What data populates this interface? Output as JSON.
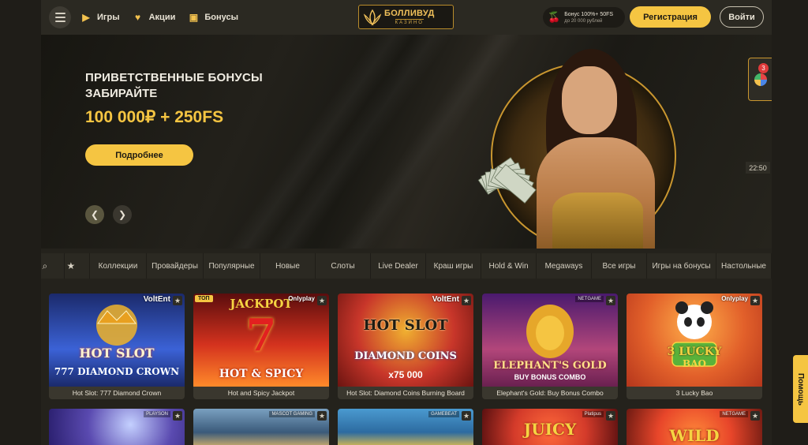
{
  "header": {
    "nav": [
      {
        "label": "Игры",
        "icon": "play-icon"
      },
      {
        "label": "Акции",
        "icon": "heart-icon"
      },
      {
        "label": "Бонусы",
        "icon": "gift-icon"
      }
    ],
    "logo_main": "БОЛЛИВУД",
    "logo_sub": "КАЗИНО",
    "promo_line1": "Бонус 100%+ 50FS",
    "promo_line2": "до 20 000 рублей",
    "register_label": "Регистрация",
    "login_label": "Войти"
  },
  "banner": {
    "line1": "ПРИВЕТСТВЕННЫЕ БОНУСЫ",
    "line2": "ЗАБИРАЙТЕ",
    "line3": "100 000₽ + 250FS",
    "button_label": "Подробнее",
    "time": "22:50",
    "notification_count": "3"
  },
  "categories": [
    "Коллекции",
    "Провайдеры",
    "Популярные",
    "Новые",
    "Слоты",
    "Live Dealer",
    "Краш игры",
    "Hold & Win",
    "Megaways",
    "Все игры",
    "Игры на бонусы",
    "Настольные"
  ],
  "games": [
    {
      "name": "Hot Slot: 777 Diamond Crown",
      "provider": "VoltEnt",
      "art_title": "HOT SLOT",
      "art_sub": "777 DIAMOND CROWN",
      "colors": [
        "#1b2a6b",
        "#3b62d6"
      ]
    },
    {
      "name": "Hot and Spicy Jackpot",
      "provider": "Onlyplay",
      "art_title": "JACKPOT",
      "art_sub": "HOT & SPICY",
      "badge": "ТОП",
      "colors": [
        "#5a0d0d",
        "#d4321e"
      ]
    },
    {
      "name": "Hot Slot: Diamond Coins Burning Board",
      "provider": "VoltEnt",
      "art_title": "HOT SLOT",
      "art_sub": "DIAMOND COINS",
      "art_extra": "x75 000",
      "colors": [
        "#6b1410",
        "#c8362a"
      ]
    },
    {
      "name": "Elephant's Gold: Buy Bonus Combo",
      "provider": "NETGAME",
      "art_title": "ELEPHANT'S GOLD",
      "art_sub": "BUY BONUS COMBO",
      "colors": [
        "#4a1a6e",
        "#b2467a"
      ]
    },
    {
      "name": "3 Lucky Bao",
      "provider": "Onlyplay",
      "art_title": "3 LUCKY",
      "art_sub": "BAO",
      "colors": [
        "#b5361c",
        "#f08a2a"
      ]
    }
  ],
  "games_row2": [
    {
      "provider": "PLAYSON",
      "colors": [
        "#2a1f6e",
        "#c4d0ff"
      ]
    },
    {
      "provider": "MASCOT GAMING",
      "colors": [
        "#3a5a7a",
        "#d9b46b"
      ]
    },
    {
      "provider": "GAMEBEAT",
      "colors": [
        "#2d6ba0",
        "#e8c24a"
      ]
    },
    {
      "provider": "Platipus",
      "art_title": "JUICY",
      "colors": [
        "#5a1010",
        "#d43b2a"
      ]
    },
    {
      "provider": "NETGAME",
      "art_title": "WILD",
      "colors": [
        "#6e1a12",
        "#e8462a"
      ]
    }
  ]
}
